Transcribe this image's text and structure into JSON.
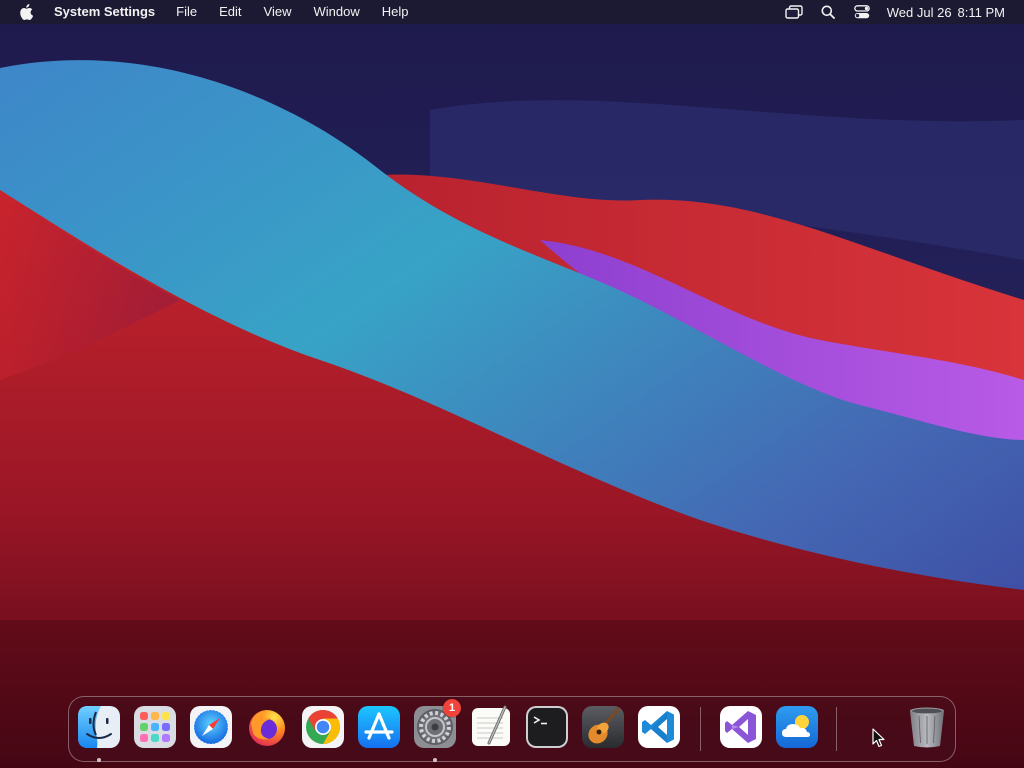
{
  "menubar": {
    "app_name": "System Settings",
    "menus": [
      "File",
      "Edit",
      "View",
      "Window",
      "Help"
    ],
    "status_icons": [
      "screen-mirroring-icon",
      "spotlight-search-icon",
      "control-center-icon"
    ],
    "clock": {
      "date": "Wed Jul 26",
      "time": "8:11 PM"
    }
  },
  "dock": {
    "apps": [
      {
        "name": "Finder",
        "icon": "finder-icon",
        "running": true
      },
      {
        "name": "Launchpad",
        "icon": "launchpad-icon",
        "running": false
      },
      {
        "name": "Safari",
        "icon": "safari-icon",
        "running": false
      },
      {
        "name": "Firefox",
        "icon": "firefox-icon",
        "running": false
      },
      {
        "name": "Google Chrome",
        "icon": "chrome-icon",
        "running": false
      },
      {
        "name": "App Store",
        "icon": "app-store-icon",
        "running": false
      },
      {
        "name": "System Settings",
        "icon": "system-settings-icon",
        "running": true,
        "badge": "1"
      },
      {
        "name": "TextEdit",
        "icon": "textedit-icon",
        "running": false
      },
      {
        "name": "Terminal",
        "icon": "terminal-icon",
        "running": false
      },
      {
        "name": "GarageBand",
        "icon": "garageband-icon",
        "running": false
      },
      {
        "name": "Visual Studio Code",
        "icon": "vscode-icon",
        "running": false
      },
      {
        "name": "Visual Studio",
        "icon": "visual-studio-icon",
        "running": false
      },
      {
        "name": "Weather",
        "icon": "weather-icon",
        "running": false
      },
      {
        "name": "Trash",
        "icon": "trash-icon",
        "running": false
      }
    ]
  },
  "colors": {
    "menubar_bg": "#1c1a30",
    "badge": "#f0443a",
    "wallpaper_top": "#221f55",
    "wallpaper_blue": "#3a9fc8",
    "wallpaper_red": "#c9242c",
    "wallpaper_purple": "#b44fd8"
  }
}
